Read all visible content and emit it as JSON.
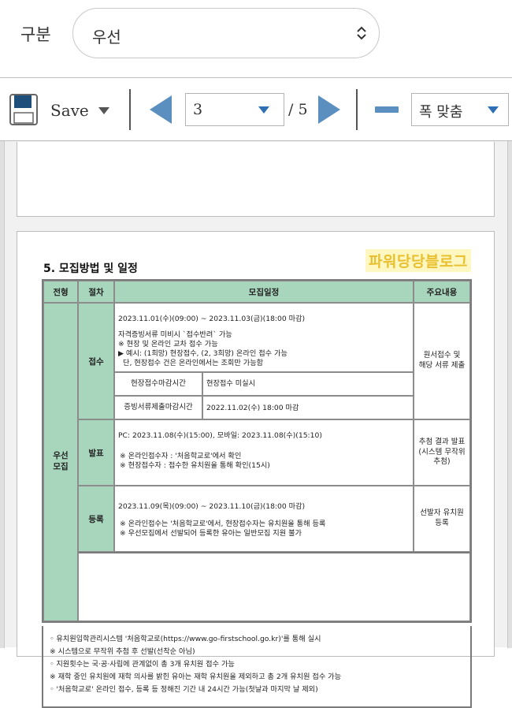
{
  "form": {
    "label": "구분",
    "select_value": "우선"
  },
  "toolbar": {
    "save_label": "Save",
    "current_page": "3",
    "total_pages": "/ 5",
    "zoom_value": "폭 맞춤"
  },
  "doc": {
    "watermark": "파워당당블로그",
    "section_title": "5. 모집방법 및 일정",
    "headers": {
      "type": "전형",
      "step": "절차",
      "schedule": "모집일정",
      "main": "주요내용"
    },
    "type_label": "우선\n모집",
    "rows": {
      "apply": {
        "step": "접수",
        "line1": "2023.11.01(수)(09:00) ~ 2023.11.03(금)(18:00 마감)",
        "line2": "자격증빙서류 미비시 `접수반려` 가능",
        "line3": "※ 현장 및 온라인 교차 접수 가능",
        "line4": "▶ 예시: (1희망) 현장접수, (2, 3희망) 온라인 접수 가능",
        "line5": "단, 현장접수 건은 온라인에서는 조회만 가능함",
        "sub1_label": "현장접수마감시간",
        "sub1_value": "현장접수 미실시",
        "sub2_label": "증빙서류제출마감시간",
        "sub2_value": "2022.11.02(수) 18:00 마감",
        "main": "원서접수 및\n해당 서류 제출"
      },
      "announce": {
        "step": "발표",
        "line1": "PC: 2023.11.08(수)(15:00), 모바일: 2023.11.08(수)(15:10)",
        "line2": "※ 온라인접수자 : '처음학교로'에서 확인",
        "line3": "※ 현장접수자 : 접수한 유치원을 통해 확인(15시)",
        "main": "추첨 결과 발표\n(시스템 무작위\n추첨)"
      },
      "register": {
        "step": "등록",
        "line1": "2023.11.09(목)(09:00) ~ 2023.11.10(금)(18:00 마감)",
        "line2": "※ 온라인접수는 '처음학교로'에서, 현장접수자는 유치원을 통해 등록",
        "line3": "※ 우선모집에서 선발되어 등록한 유아는 일반모집 지원 불가",
        "main": "선발자 유치원\n등록"
      }
    },
    "notes": [
      "◦ 유치원입학관리시스템 '처음학교로(https://www.go-firstschool.go.kr)'를 통해 실시",
      "※ 시스템으로 무작위 추첨 후 선발(선착순 아님)",
      "◦ 지원횟수는 국·공·사립에 관계없이 총 3개 유치원 접수 가능",
      "※ 재학 중인 유치원에 재학 의사를 밝힌 유아는 재학 유치원을 제외하고 총 2개 유치원 접수 가능",
      "◦ '처음학교로' 온라인 접수, 등록 등 정해진 기간 내 24시간 가능(첫날과 마지막 날 제외)"
    ]
  },
  "colors": {
    "arrow": "#5b8fbf",
    "header_green": "#a8d6bc",
    "watermark": "#e8c030"
  },
  "icons": [
    "chevron-up-down-icon",
    "save-disk-icon",
    "caret-down-icon",
    "prev-page-icon",
    "next-page-icon",
    "zoom-out-icon"
  ]
}
